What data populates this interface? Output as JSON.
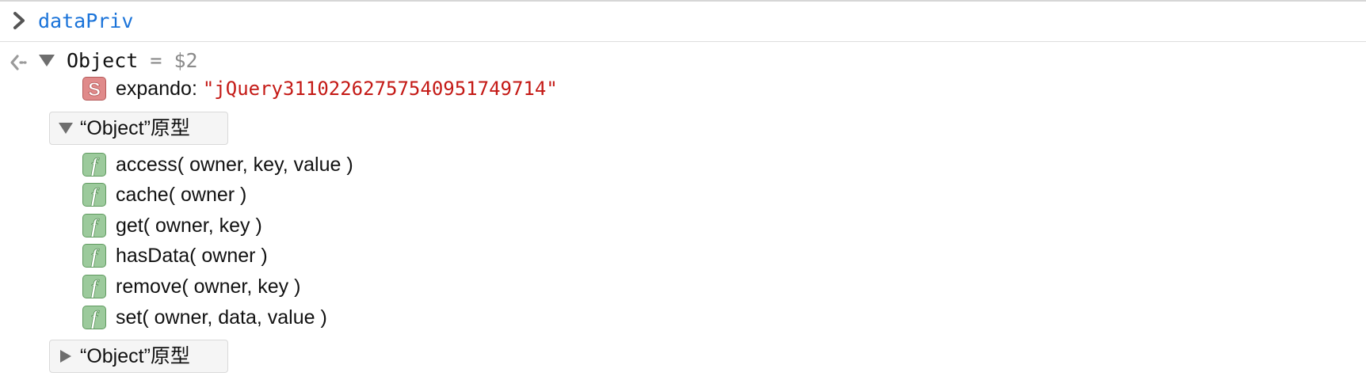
{
  "console": {
    "input": {
      "icon": "chevron-right-icon",
      "command": "dataPriv"
    },
    "result": {
      "icon": "back-arrow-icon",
      "object_name": "Object",
      "equals": "=",
      "var_name": "$2",
      "properties": [
        {
          "badge": "S",
          "badge_icon": "string-badge-icon",
          "name": "expando",
          "separator": ":",
          "value": "\"jQuery31102262757540951749714\""
        }
      ],
      "prototypes": [
        {
          "label": "“Object”原型",
          "expanded": true,
          "methods": [
            {
              "badge": "f",
              "badge_icon": "function-badge-icon",
              "signature": "access( owner, key, value )"
            },
            {
              "badge": "f",
              "badge_icon": "function-badge-icon",
              "signature": "cache( owner )"
            },
            {
              "badge": "f",
              "badge_icon": "function-badge-icon",
              "signature": "get( owner, key )"
            },
            {
              "badge": "f",
              "badge_icon": "function-badge-icon",
              "signature": "hasData( owner )"
            },
            {
              "badge": "f",
              "badge_icon": "function-badge-icon",
              "signature": "remove( owner, key )"
            },
            {
              "badge": "f",
              "badge_icon": "function-badge-icon",
              "signature": "set( owner, data, value )"
            }
          ]
        },
        {
          "label": "“Object”原型",
          "expanded": false,
          "methods": []
        }
      ]
    }
  },
  "colors": {
    "command_blue": "#1a73d9",
    "string_red": "#c41a16",
    "string_badge": "#e08a8a",
    "function_badge": "#8cc08c",
    "muted_gray": "#8a8a8a"
  }
}
